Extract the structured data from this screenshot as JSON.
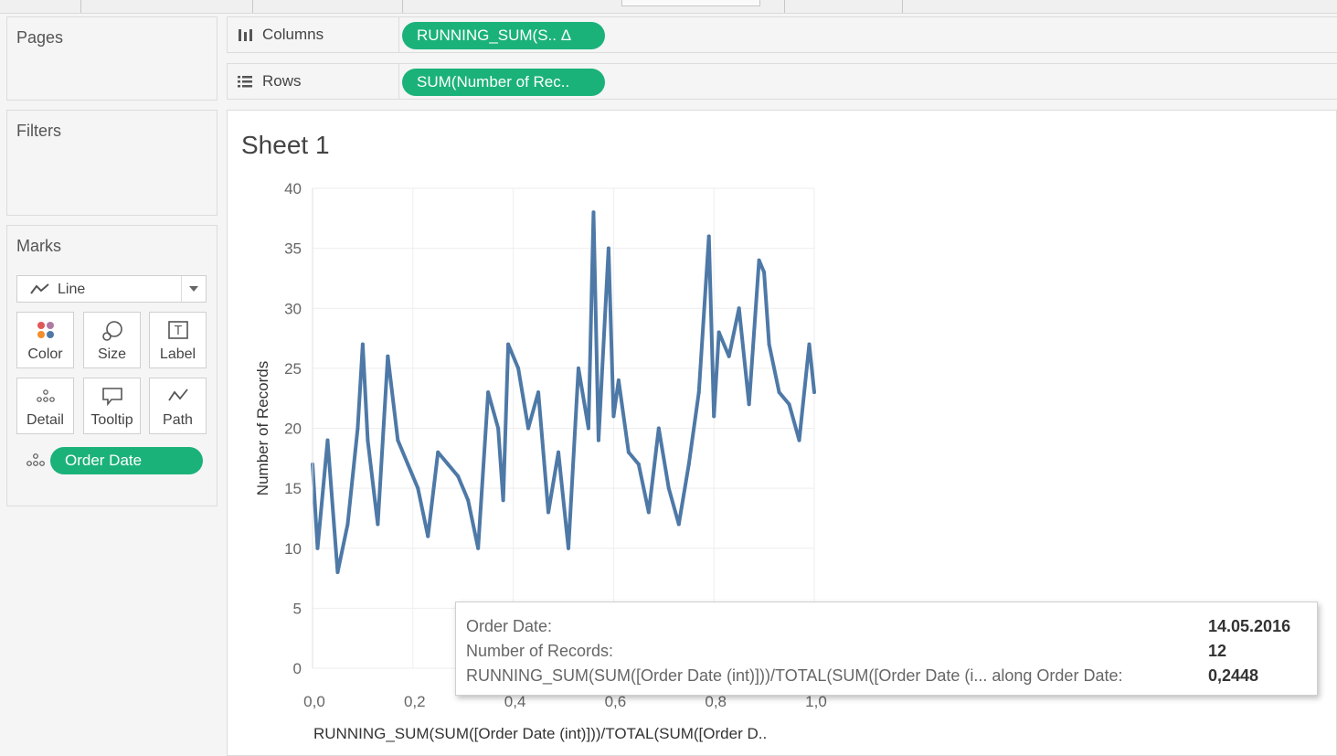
{
  "pages_card": {
    "title": "Pages"
  },
  "filters_card": {
    "title": "Filters"
  },
  "marks_card": {
    "title": "Marks",
    "mark_type": "Line",
    "buttons": [
      {
        "label": "Color",
        "icon": "color-dots-icon"
      },
      {
        "label": "Size",
        "icon": "size-icon"
      },
      {
        "label": "Label",
        "icon": "label-text-icon"
      },
      {
        "label": "Detail",
        "icon": "detail-dots-icon"
      },
      {
        "label": "Tooltip",
        "icon": "tooltip-bubble-icon"
      },
      {
        "label": "Path",
        "icon": "path-line-icon"
      }
    ],
    "detail_pill": "Order Date"
  },
  "shelves": {
    "columns": {
      "label": "Columns",
      "pill": "RUNNING_SUM(S..  Δ"
    },
    "rows": {
      "label": "Rows",
      "pill": "SUM(Number of Rec.."
    }
  },
  "sheet": {
    "title": "Sheet 1"
  },
  "colors": {
    "pill": "#1bb27a",
    "line": "#4e79a7"
  },
  "chart_data": {
    "type": "line",
    "title": "Sheet 1",
    "xlabel": "RUNNING_SUM(SUM([Order Date (int)]))/TOTAL(SUM([Order D..",
    "ylabel": "Number of Records",
    "xlim": [
      0,
      1.0
    ],
    "ylim": [
      0,
      40
    ],
    "x_ticks": [
      "0,0",
      "0,2",
      "0,4",
      "0,6",
      "0,8",
      "1,0"
    ],
    "y_ticks": [
      0,
      5,
      10,
      15,
      20,
      25,
      30,
      35,
      40
    ],
    "grid": true,
    "series": [
      {
        "x": [
          0.0,
          0.01,
          0.03,
          0.05,
          0.07,
          0.09,
          0.1,
          0.11,
          0.13,
          0.15,
          0.17,
          0.19,
          0.21,
          0.23,
          0.25,
          0.27,
          0.29,
          0.31,
          0.33,
          0.35,
          0.37,
          0.38,
          0.39,
          0.41,
          0.43,
          0.45,
          0.47,
          0.49,
          0.51,
          0.53,
          0.55,
          0.56,
          0.57,
          0.59,
          0.6,
          0.61,
          0.63,
          0.65,
          0.67,
          0.69,
          0.71,
          0.73,
          0.75,
          0.77,
          0.79,
          0.8,
          0.81,
          0.83,
          0.85,
          0.87,
          0.89,
          0.9,
          0.91,
          0.93,
          0.95,
          0.97,
          0.99,
          1.0
        ],
        "values": [
          17,
          10,
          19,
          8,
          12,
          20,
          27,
          19,
          12,
          26,
          19,
          17,
          15,
          11,
          18,
          17,
          16,
          14,
          10,
          23,
          20,
          14,
          27,
          25,
          20,
          23,
          13,
          18,
          10,
          25,
          20,
          38,
          19,
          35,
          21,
          24,
          18,
          17,
          13,
          20,
          15,
          12,
          17,
          23,
          36,
          21,
          28,
          26,
          30,
          22,
          34,
          33,
          27,
          23,
          22,
          19,
          27,
          23
        ]
      }
    ]
  },
  "tooltip": {
    "rows": [
      {
        "label": "Order Date:",
        "value": "14.05.2016"
      },
      {
        "label": "Number of Records:",
        "value": "12"
      },
      {
        "label": "RUNNING_SUM(SUM([Order Date (int)]))/TOTAL(SUM([Order Date (i... along Order Date:",
        "value": "0,2448"
      }
    ]
  }
}
